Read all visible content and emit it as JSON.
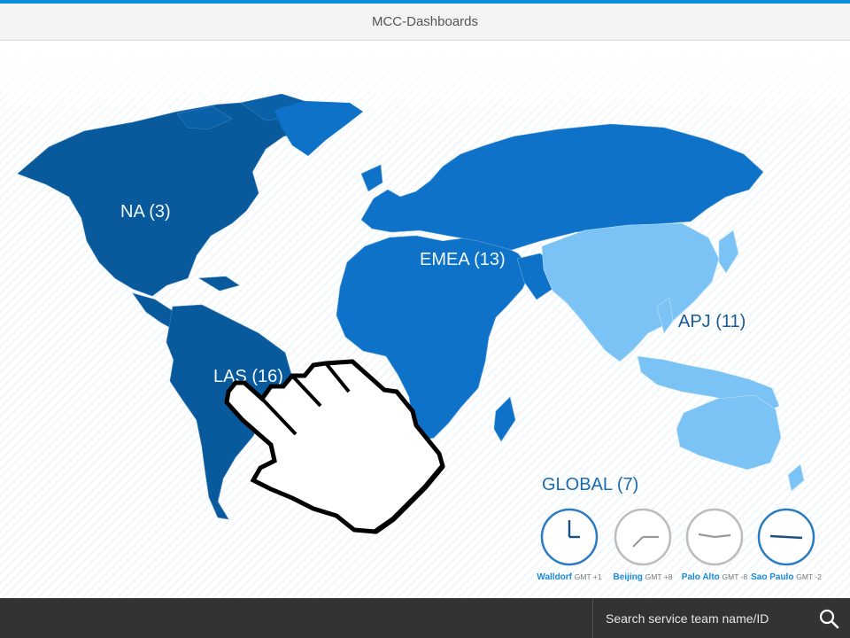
{
  "header": {
    "title": "MCC-Dashboards"
  },
  "colors": {
    "accent": "#0a8fdc",
    "region_dark": "#095a9c",
    "region_mid": "#0e72c8",
    "region_light": "#7cc3f5",
    "footer": "#333333"
  },
  "regions": [
    {
      "id": "na",
      "label": "NA (3)"
    },
    {
      "id": "emea",
      "label": "EMEA (13)"
    },
    {
      "id": "apj",
      "label": "APJ (11)"
    },
    {
      "id": "las",
      "label": "LAS (16)"
    }
  ],
  "global": {
    "label": "GLOBAL (7)"
  },
  "clocks": [
    {
      "city": "Walldorf",
      "gmt": "GMT +1"
    },
    {
      "city": "Beijing",
      "gmt": "GMT +8"
    },
    {
      "city": "Palo Alto",
      "gmt": "GMT -8"
    },
    {
      "city": "Sao Paulo",
      "gmt": "GMT -2"
    }
  ],
  "search": {
    "placeholder": "Search service team name/ID"
  },
  "icons": {
    "search": "search-icon",
    "cursor": "hand-pointer-icon"
  }
}
